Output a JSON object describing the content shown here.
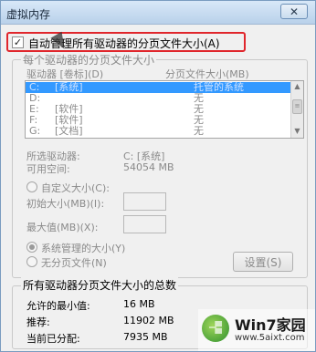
{
  "window": {
    "title": "虚拟内存",
    "close_glyph": "✕"
  },
  "auto_manage": {
    "label": "自动管理所有驱动器的分页文件大小(A)",
    "checked": true
  },
  "per_drive": {
    "legend": "每个驱动器的分页文件大小",
    "col_drive": "驱动器 [卷标](D)",
    "col_size": "分页文件大小(MB)",
    "drives": [
      {
        "drive": "C:",
        "label": "[系统]",
        "size": "托管的系统",
        "selected": true
      },
      {
        "drive": "D:",
        "label": "",
        "size": "无",
        "selected": false
      },
      {
        "drive": "E:",
        "label": "[软件]",
        "size": "无",
        "selected": false
      },
      {
        "drive": "F:",
        "label": "[软件]",
        "size": "无",
        "selected": false
      },
      {
        "drive": "G:",
        "label": "[文档]",
        "size": "无",
        "selected": false
      }
    ],
    "selected_drive_label": "所选驱动器:",
    "selected_drive_value": "C:  [系统]",
    "free_space_label": "可用空间:",
    "free_space_value": "54054 MB",
    "custom_size_label": "自定义大小(C):",
    "initial_size_label": "初始大小(MB)(I):",
    "max_size_label": "最大值(MB)(X):",
    "system_managed_label": "系统管理的大小(Y)",
    "no_paging_label": "无分页文件(N)",
    "set_button": "设置(S)"
  },
  "totals": {
    "legend": "所有驱动器分页文件大小的总数",
    "min_label": "允许的最小值:",
    "min_value": "16 MB",
    "recommended_label": "推荐:",
    "recommended_value": "11902 MB",
    "current_label": "当前已分配:",
    "current_value": "7935 MB"
  },
  "watermark": {
    "title": "Win7家园",
    "url": "www.5aixt.com"
  },
  "icons": {
    "checkbox": "check-mark",
    "scroll_up": "▲",
    "scroll_down": "▼",
    "scroll_thumb": "≡"
  }
}
